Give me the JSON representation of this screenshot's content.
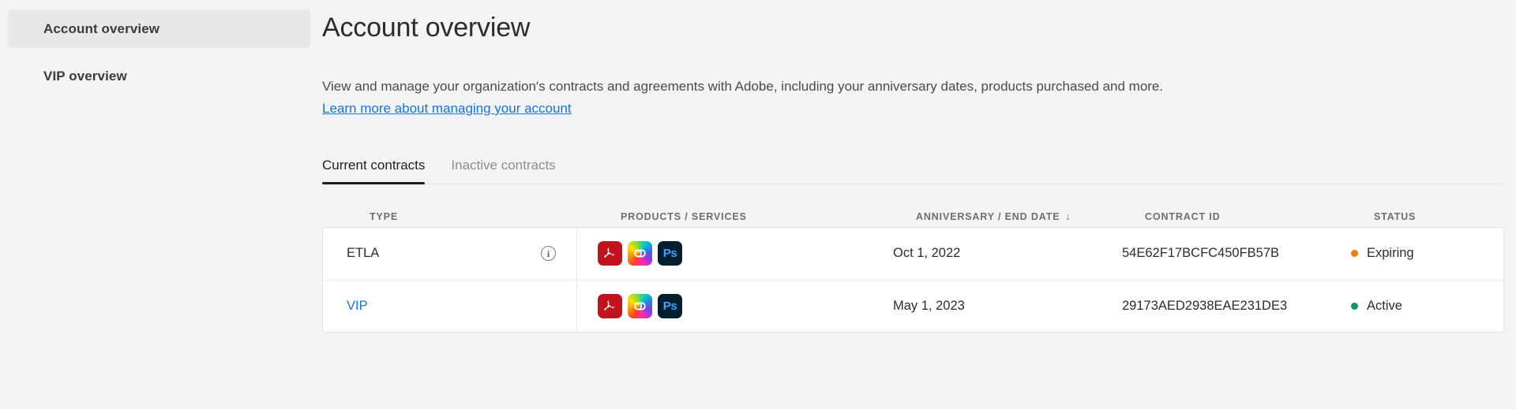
{
  "sidebar": {
    "items": [
      {
        "label": "Account overview",
        "selected": true
      },
      {
        "label": "VIP overview",
        "selected": false
      }
    ]
  },
  "header": {
    "title": "Account overview",
    "description": "View and manage your organization's contracts and agreements with Adobe, including your anniversary dates, products purchased and more.",
    "link_label": "Learn more about managing your account"
  },
  "tabs": [
    {
      "label": "Current contracts",
      "active": true
    },
    {
      "label": "Inactive contracts",
      "active": false
    }
  ],
  "table": {
    "columns": {
      "type": "TYPE",
      "products": "PRODUCTS / SERVICES",
      "anniversary": "ANNIVERSARY / END DATE",
      "sort_icon": "↓",
      "contract_id": "CONTRACT ID",
      "status": "STATUS"
    },
    "rows": [
      {
        "type": "ETLA",
        "type_is_link": false,
        "info_icon": "i",
        "has_info": true,
        "products": [
          "acrobat-icon",
          "creative-cloud-icon",
          "photoshop-icon"
        ],
        "product_glyphs": {
          "acrobat": "",
          "creative_cloud": "",
          "photoshop": "Ps"
        },
        "anniversary": "Oct 1, 2022",
        "contract_id": "54E62F17BCFC450FB57B",
        "status": "Expiring",
        "status_color": "#e8820c"
      },
      {
        "type": "VIP",
        "type_is_link": true,
        "info_icon": "",
        "has_info": false,
        "products": [
          "acrobat-icon",
          "creative-cloud-icon",
          "photoshop-icon"
        ],
        "product_glyphs": {
          "acrobat": "",
          "creative_cloud": "",
          "photoshop": "Ps"
        },
        "anniversary": "May 1, 2023",
        "contract_id": "29173AED2938EAE231DE3",
        "status": "Active",
        "status_color": "#069a5a"
      }
    ]
  },
  "colors": {
    "link": "#1473e6",
    "page_bg": "#f4f4f4",
    "selected_nav_bg": "#e8e8e8",
    "status_expiring": "#e8820c",
    "status_active": "#069a5a"
  }
}
